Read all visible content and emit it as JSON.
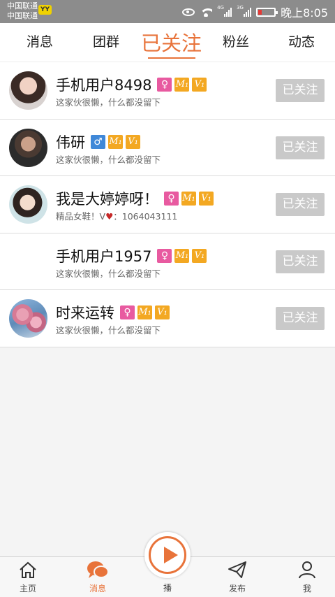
{
  "status_bar": {
    "carrier_1": "中国联通",
    "carrier_2": "中国联通",
    "carrier_badge": "YY",
    "signal_1": "4G",
    "signal_2": "3G",
    "time": "晚上8:05"
  },
  "tabs": [
    {
      "label": "消息"
    },
    {
      "label": "团群"
    },
    {
      "label": "已关注",
      "active": true
    },
    {
      "label": "粉丝"
    },
    {
      "label": "动态"
    }
  ],
  "follow_list": [
    {
      "name": "手机用户8498",
      "gender": "female",
      "gender_symbol": "♀",
      "level_m": "M₁",
      "level_v": "V₁",
      "bio": "这家伙很懒，什么都没留下",
      "button": "已关注"
    },
    {
      "name": "伟研",
      "gender": "male",
      "gender_symbol": "♂",
      "level_m": "M₁",
      "level_v": "V₁",
      "bio": "这家伙很懒，什么都没留下",
      "button": "已关注"
    },
    {
      "name": "我是大婷婷呀！",
      "gender": "female",
      "gender_symbol": "♀",
      "level_m": "M₁",
      "level_v": "V₁",
      "bio_prefix": "精品女鞋！V",
      "bio_heart": "♥",
      "bio_suffix": "：1064043111",
      "button": "已关注"
    },
    {
      "name": "手机用户1957",
      "gender": "female",
      "gender_symbol": "♀",
      "level_m": "M₁",
      "level_v": "V₁",
      "bio": "这家伙很懒，什么都没留下",
      "button": "已关注"
    },
    {
      "name": "时来运转",
      "gender": "female",
      "gender_symbol": "♀",
      "level_m": "M₁",
      "level_v": "V₁",
      "bio": "这家伙很懒，什么都没留下",
      "button": "已关注"
    }
  ],
  "bottom_nav": {
    "home": "主页",
    "messages": "消息",
    "play": "播",
    "publish": "发布",
    "me": "我"
  },
  "colors": {
    "accent": "#e8733a",
    "female": "#e85aa0",
    "male": "#3f88d8",
    "level": "#f3a822",
    "followed_button": "#c9c9c9"
  }
}
